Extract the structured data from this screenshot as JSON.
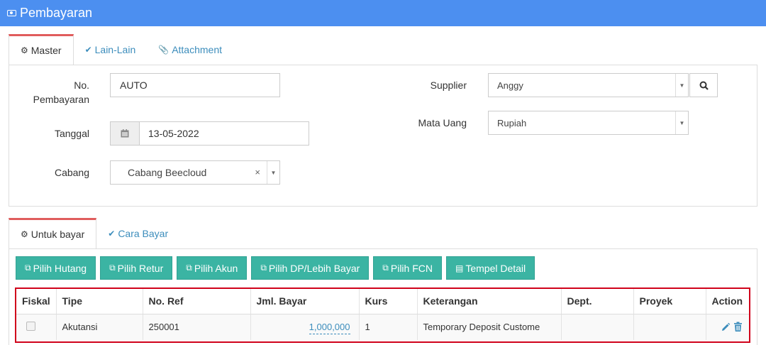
{
  "window": {
    "title": "Pembayaran",
    "icon": "money-icon"
  },
  "master_tabs": [
    {
      "label": "Master",
      "icon": "cogs-icon",
      "active": true
    },
    {
      "label": "Lain-Lain",
      "icon": "check-circle-icon",
      "active": false
    },
    {
      "label": "Attachment",
      "icon": "paperclip-icon",
      "active": false
    }
  ],
  "form": {
    "no_pembayaran_label_line1": "No.",
    "no_pembayaran_label_line2": "Pembayaran",
    "no_pembayaran_value": "AUTO",
    "tanggal_label": "Tanggal",
    "tanggal_value": "13-05-2022",
    "cabang_label": "Cabang",
    "cabang_value": "Cabang Beecloud",
    "supplier_label": "Supplier",
    "supplier_value": "Anggy",
    "mata_uang_label": "Mata Uang",
    "mata_uang_value": "Rupiah"
  },
  "detail_tabs": [
    {
      "label": "Untuk bayar",
      "icon": "cogs-icon",
      "active": true
    },
    {
      "label": "Cara Bayar",
      "icon": "check-circle-icon",
      "active": false
    }
  ],
  "action_buttons": [
    "Pilih Hutang",
    "Pilih Retur",
    "Pilih Akun",
    "Pilih DP/Lebih Bayar",
    "Pilih FCN",
    "Tempel Detail"
  ],
  "table": {
    "headers": [
      "Fiskal",
      "Tipe",
      "No. Ref",
      "Jml. Bayar",
      "Kurs",
      "Keterangan",
      "Dept.",
      "Proyek",
      "Action"
    ],
    "rows": [
      {
        "fiskal": false,
        "tipe": "Akutansi",
        "no_ref": "250001",
        "jml_bayar": "1,000,000",
        "kurs": "1",
        "keterangan": "Temporary Deposit Custome",
        "dept": "",
        "proyek": ""
      }
    ]
  },
  "colors": {
    "header_bg": "#4c8ff0",
    "button_bg": "#3bb4a3",
    "link": "#3c8dbc",
    "active_tab_accent": "#e05d5d",
    "highlight_border": "#d0021b"
  }
}
